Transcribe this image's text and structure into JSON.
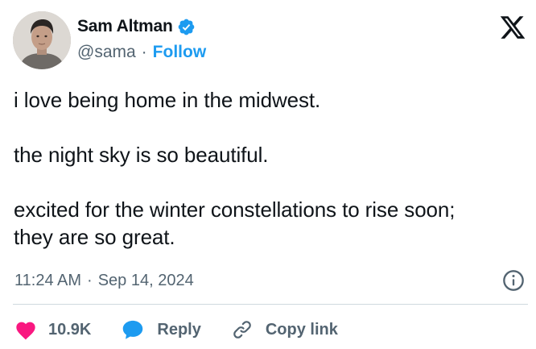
{
  "author": {
    "display_name": "Sam Altman",
    "handle": "@sama",
    "separator": "·",
    "follow_label": "Follow",
    "verified_icon": "verified-badge-icon",
    "verified_color": "#1d9bf0"
  },
  "brand": {
    "logo": "x-logo-icon"
  },
  "tweet": {
    "line1": "i love being home in the midwest.",
    "line2": "the night sky is so beautiful.",
    "line3": "excited for the winter constellations to rise soon;",
    "line4": "they are so great."
  },
  "meta": {
    "time": "11:24 AM",
    "separator": "·",
    "date": "Sep 14, 2024"
  },
  "actions": {
    "like_count": "10.9K",
    "reply_label": "Reply",
    "copy_link_label": "Copy link"
  },
  "colors": {
    "like": "#f91880",
    "reply": "#1d9bf0",
    "follow": "#1d9bf0",
    "secondary_text": "#536471",
    "primary_text": "#0f1419"
  }
}
